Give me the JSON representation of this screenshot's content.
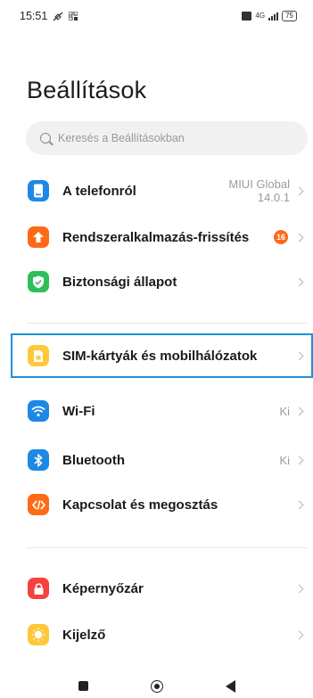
{
  "status_bar": {
    "time": "15:51",
    "network_label": "4G",
    "battery": "75"
  },
  "page": {
    "title": "Beállítások"
  },
  "search": {
    "placeholder": "Keresés a Beállításokban"
  },
  "settings": {
    "items": [
      {
        "label": "A telefonról",
        "value_line1": "MIUI Global",
        "value_line2": "14.0.1",
        "icon": "phone-icon",
        "color": "#1e88e5"
      },
      {
        "label": "Rendszeralkalmazás-frissítés",
        "badge": "16",
        "icon": "arrow-up-icon",
        "color": "#ff6a16"
      },
      {
        "label": "Biztonsági állapot",
        "icon": "shield-check-icon",
        "color": "#2fbf5a"
      },
      {
        "label": "SIM-kártyák és mobilhálózatok",
        "icon": "sim-card-icon",
        "color": "#ffc83a"
      },
      {
        "label": "Wi-Fi",
        "value": "Ki",
        "icon": "wifi-icon",
        "color": "#1e88e5"
      },
      {
        "label": "Bluetooth",
        "value": "Ki",
        "icon": "bluetooth-icon",
        "color": "#1e88e5"
      },
      {
        "label": "Kapcsolat és megosztás",
        "icon": "connection-sharing-icon",
        "color": "#ff6a16"
      },
      {
        "label": "Képernyőzár",
        "icon": "lock-icon",
        "color": "#f5423f"
      },
      {
        "label": "Kijelző",
        "icon": "sun-icon",
        "color": "#ffc83a"
      }
    ]
  },
  "colors": {
    "highlight": "#1e90d6",
    "badge": "#ff6a16"
  }
}
